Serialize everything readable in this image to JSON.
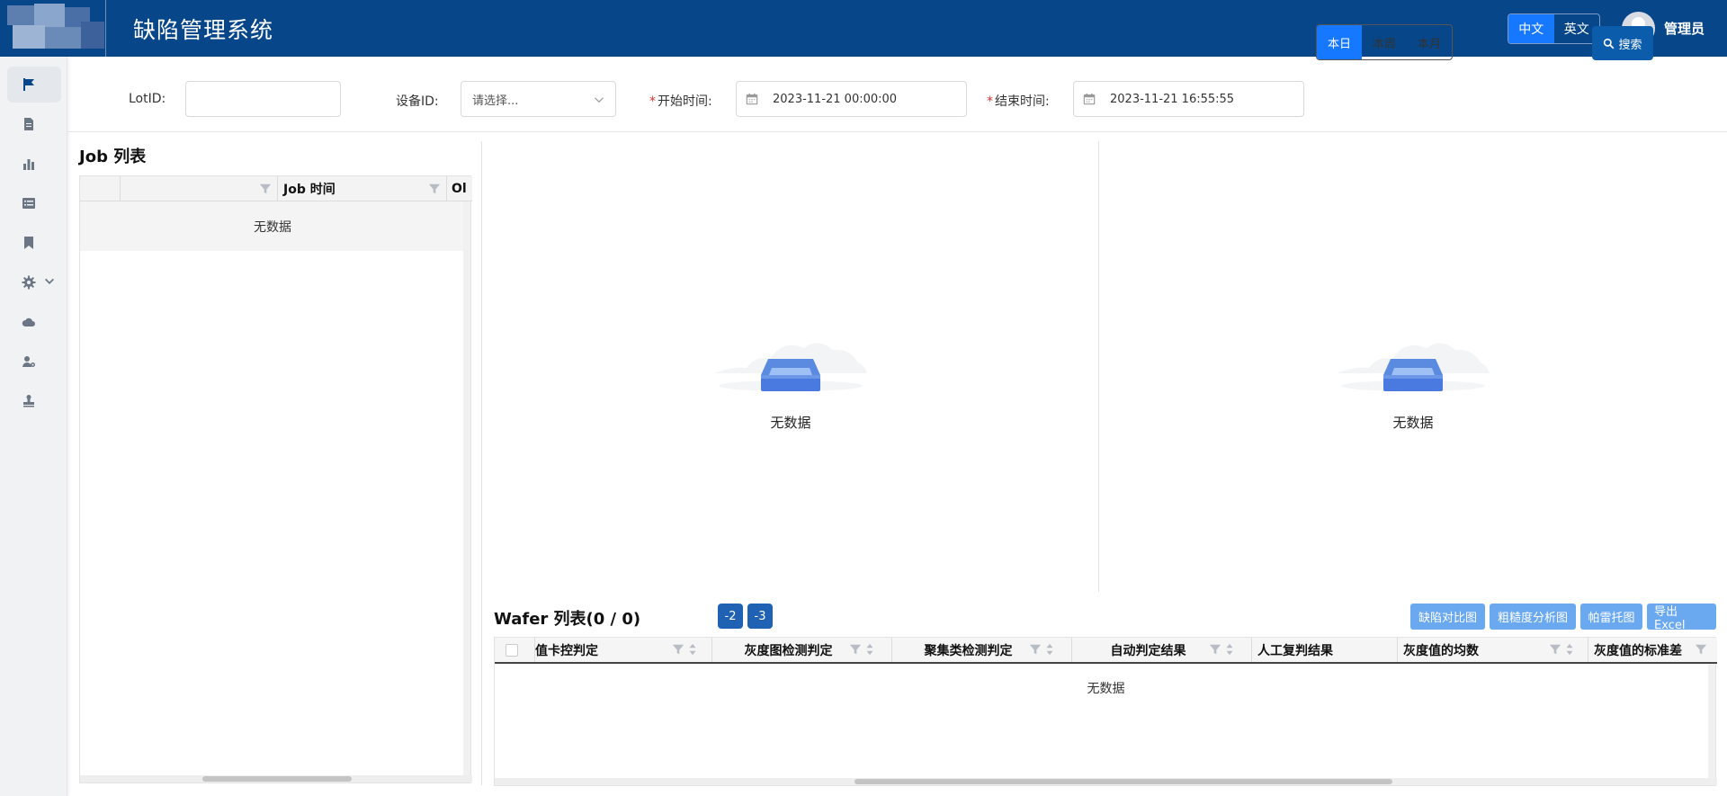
{
  "header": {
    "title": "缺陷管理系统",
    "lang_options": [
      "中文",
      "英文"
    ],
    "lang_active": "中文",
    "username": "管理员"
  },
  "sidebar": {
    "items": [
      {
        "icon": "flag-icon",
        "active": true
      },
      {
        "icon": "document-icon"
      },
      {
        "icon": "bar-chart-icon"
      },
      {
        "icon": "list-icon"
      },
      {
        "icon": "bookmark-icon"
      },
      {
        "icon": "gear-icon",
        "expandable": true
      },
      {
        "icon": "cloud-icon"
      },
      {
        "icon": "user-settings-icon"
      },
      {
        "icon": "stamp-icon"
      }
    ]
  },
  "filters": {
    "lot_id_label": "LotID:",
    "lot_id_value": "",
    "device_label": "设备ID:",
    "device_placeholder": "请选择...",
    "start_label": "开始时间:",
    "start_value": "2023-11-21 00:00:00",
    "end_label": "结束时间:",
    "end_value": "2023-11-21 16:55:55",
    "ranges": [
      "本日",
      "本周",
      "本月"
    ],
    "range_active": "本日",
    "search_label": "搜索"
  },
  "job_list": {
    "title": "Job 列表",
    "columns": [
      "",
      "",
      "Job 时间",
      "Ol"
    ],
    "empty_text": "无数据"
  },
  "charts": {
    "left_empty_text": "无数据",
    "right_empty_text": "无数据"
  },
  "wafer_list": {
    "title": "Wafer 列表(0 / 0)",
    "nav_buttons": [
      "-2",
      "-3"
    ],
    "actions": [
      "缺陷对比图",
      "粗糙度分析图",
      "帕雷托图",
      "导出 Excel"
    ],
    "columns": [
      "值卡控判定",
      "灰度图检测判定",
      "聚集类检测判定",
      "自动判定结果",
      "人工复判结果",
      "灰度值的均数",
      "灰度值的标准差"
    ],
    "empty_text": "无数据"
  }
}
